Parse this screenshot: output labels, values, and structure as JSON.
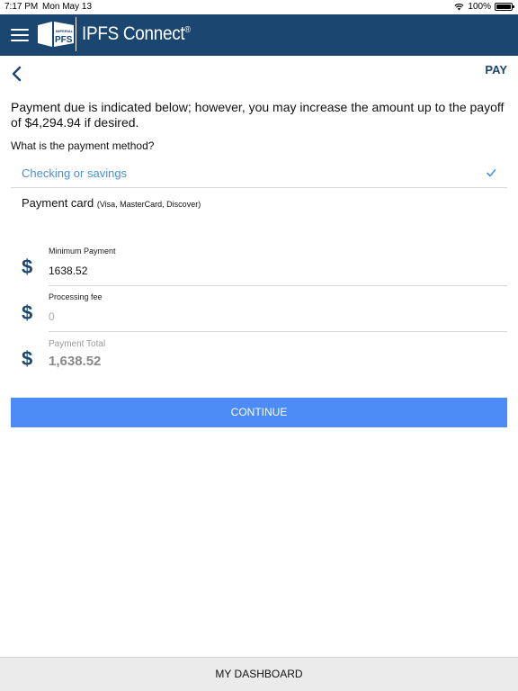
{
  "status_bar": {
    "time": "7:17 PM",
    "date": "Mon May 13",
    "battery": "100%"
  },
  "header": {
    "brand": "IPFS Connect",
    "registered": "®",
    "logo_top": "IMPERIAL",
    "logo_main": "PFS"
  },
  "nav": {
    "action_label": "PAY"
  },
  "intro_text": "Payment due is indicated below; however, you may increase the amount up to the payoff of $4,294.94 if desired.",
  "method_question": "What is the payment method?",
  "methods": [
    {
      "label": "Checking or savings",
      "sub": "",
      "selected": true
    },
    {
      "label": "Payment card",
      "sub": "(Visa, MasterCard, Discover)",
      "selected": false
    }
  ],
  "amounts": {
    "currency_symbol": "$",
    "minimum": {
      "label": "Minimum Payment",
      "value": "1638.52"
    },
    "fee": {
      "label": "Processing fee",
      "placeholder": "0"
    },
    "total": {
      "label": "Payment Total",
      "value": "1,638.52"
    }
  },
  "continue_label": "CONTINUE",
  "footer_label": "MY DASHBOARD",
  "colors": {
    "header": "#1a4670",
    "accent": "#4a90d9",
    "button": "#4d8bf6"
  }
}
